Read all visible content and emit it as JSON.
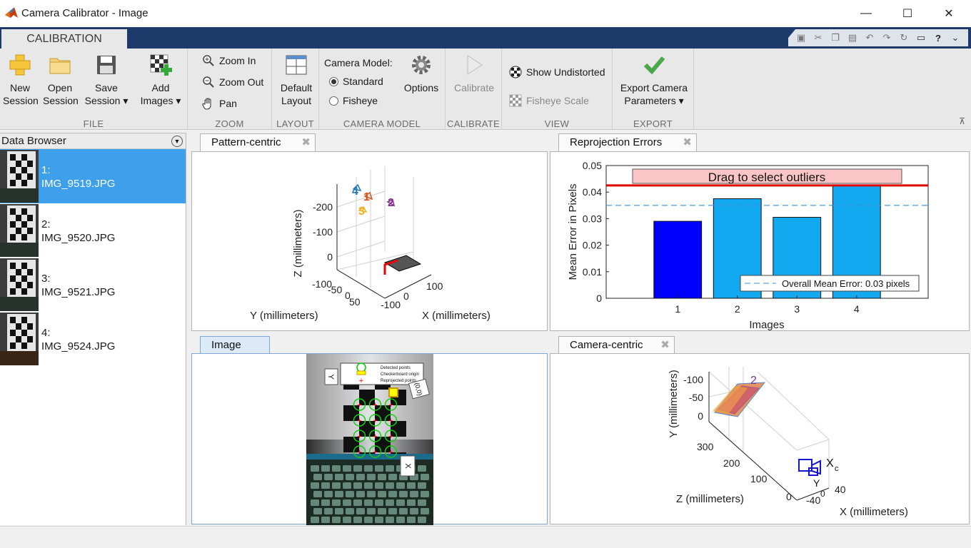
{
  "window": {
    "title": "Camera Calibrator - Image",
    "minimize": "—",
    "maximize": "☐",
    "close": "✕"
  },
  "ribbon": {
    "tab": "CALIBRATION",
    "file": {
      "label": "FILE",
      "new_session": [
        "New",
        "Session"
      ],
      "open_session": [
        "Open",
        "Session"
      ],
      "save_session": [
        "Save",
        "Session"
      ],
      "add_images": [
        "Add",
        "Images"
      ]
    },
    "zoom": {
      "label": "ZOOM",
      "zoom_in": "Zoom In",
      "zoom_out": "Zoom Out",
      "pan": "Pan"
    },
    "layout": {
      "label": "LAYOUT",
      "default_layout": [
        "Default",
        "Layout"
      ]
    },
    "camera_model": {
      "label": "CAMERA MODEL",
      "title": "Camera Model:",
      "standard": "Standard",
      "fisheye": "Fisheye",
      "selected": "Standard",
      "options": "Options"
    },
    "calibrate": {
      "label": "CALIBRATE",
      "calibrate": "Calibrate"
    },
    "view": {
      "label": "VIEW",
      "show_undistorted": "Show Undistorted",
      "fisheye_scale": "Fisheye Scale"
    },
    "export": {
      "label": "EXPORT",
      "export_params": [
        "Export Camera",
        "Parameters"
      ]
    }
  },
  "data_browser": {
    "title": "Data Browser",
    "items": [
      {
        "index": "1:",
        "name": "IMG_9519.JPG",
        "selected": true
      },
      {
        "index": "2:",
        "name": "IMG_9520.JPG",
        "selected": false
      },
      {
        "index": "3:",
        "name": "IMG_9521.JPG",
        "selected": false
      },
      {
        "index": "4:",
        "name": "IMG_9524.JPG",
        "selected": false
      }
    ]
  },
  "panels": {
    "pattern_centric": {
      "tab": "Pattern-centric",
      "zlabel": "Z (millimeters)",
      "ylabel": "Y (millimeters)",
      "xlabel": "X (millimeters)",
      "zticks": [
        "-200",
        "-100",
        "0"
      ],
      "yticks": [
        "-100",
        "-50",
        "0",
        "50"
      ],
      "xticks": [
        "100",
        "0",
        "-100"
      ],
      "markers": [
        "4",
        "1",
        "2",
        "3"
      ]
    },
    "reprojection": {
      "tab": "Reprojection Errors",
      "banner": "Drag to select outliers",
      "legend": "Overall Mean Error: 0.03 pixels"
    },
    "image": {
      "tab": "Image",
      "legend": [
        "Detected points",
        "Checkerboard origin",
        "Reprojected points"
      ],
      "axis_y": "Y",
      "axis_x": "X",
      "origin_label": "(0,0)"
    },
    "camera_centric": {
      "tab": "Camera-centric",
      "ylabel": "Y (millimeters)",
      "zlabel": "Z (millimeters)",
      "xlabel": "X (millimeters)",
      "yticks": [
        "-100",
        "-50",
        "0"
      ],
      "zticks": [
        "300",
        "200",
        "100",
        "0"
      ],
      "xticks": [
        "-40",
        "0",
        "40"
      ],
      "camera_label": "X",
      "camera_label_sub": "c",
      "camera_y": "Y",
      "pattern_marker": "2"
    }
  },
  "chart_data": {
    "type": "bar",
    "title": "",
    "xlabel": "Images",
    "ylabel": "Mean Error in Pixels",
    "categories": [
      "1",
      "2",
      "3",
      "4"
    ],
    "values": [
      0.029,
      0.0375,
      0.0305,
      0.0425
    ],
    "bar_colors": [
      "#0000ff",
      "#12a9f0",
      "#12a9f0",
      "#12a9f0"
    ],
    "ylim": [
      0,
      0.05
    ],
    "yticks": [
      "0",
      "0.01",
      "0.02",
      "0.03",
      "0.04",
      "0.05"
    ],
    "overall_mean": 0.035,
    "threshold": 0.0425,
    "legend_placement": "bottom-right",
    "grid": false
  }
}
